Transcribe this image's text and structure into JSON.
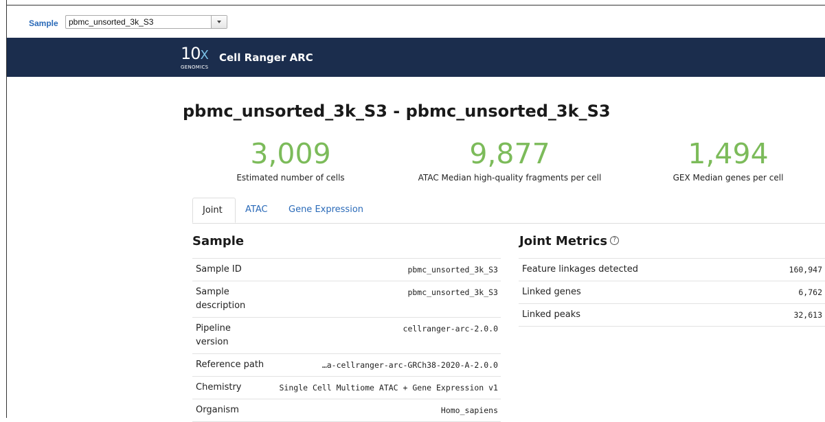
{
  "selector": {
    "label": "Sample",
    "selected": "pbmc_unsorted_3k_S3"
  },
  "header": {
    "logo_main": "10",
    "logo_x": "X",
    "logo_sub": "GENOMICS",
    "app_title": "Cell Ranger ARC"
  },
  "page_title": "pbmc_unsorted_3k_S3 - pbmc_unsorted_3k_S3",
  "hero": [
    {
      "value": "3,009",
      "label": "Estimated number of cells"
    },
    {
      "value": "9,877",
      "label": "ATAC Median high-quality fragments per cell"
    },
    {
      "value": "1,494",
      "label": "GEX Median genes per cell"
    }
  ],
  "tabs": [
    {
      "label": "Joint",
      "active": true
    },
    {
      "label": "ATAC",
      "active": false
    },
    {
      "label": "Gene Expression",
      "active": false
    }
  ],
  "sample_section": {
    "title": "Sample",
    "rows": [
      {
        "key": "Sample ID",
        "value": "pbmc_unsorted_3k_S3"
      },
      {
        "key": "Sample description",
        "value": "pbmc_unsorted_3k_S3"
      },
      {
        "key": "Pipeline version",
        "value": "cellranger-arc-2.0.0"
      },
      {
        "key": "Reference path",
        "value": "…a-cellranger-arc-GRCh38-2020-A-2.0.0"
      },
      {
        "key": "Chemistry",
        "value": "Single Cell Multiome ATAC + Gene Expression v1"
      },
      {
        "key": "Organism",
        "value": "Homo_sapiens"
      }
    ]
  },
  "joint_section": {
    "title": "Joint Metrics",
    "help_icon": "?",
    "rows": [
      {
        "key": "Feature linkages detected",
        "value": "160,947"
      },
      {
        "key": "Linked genes",
        "value": "6,762"
      },
      {
        "key": "Linked peaks",
        "value": "32,613"
      }
    ]
  },
  "colors": {
    "header_bg": "#1b2d4d",
    "metric_green": "#7cbb5a",
    "link_blue": "#2a6ab8"
  }
}
